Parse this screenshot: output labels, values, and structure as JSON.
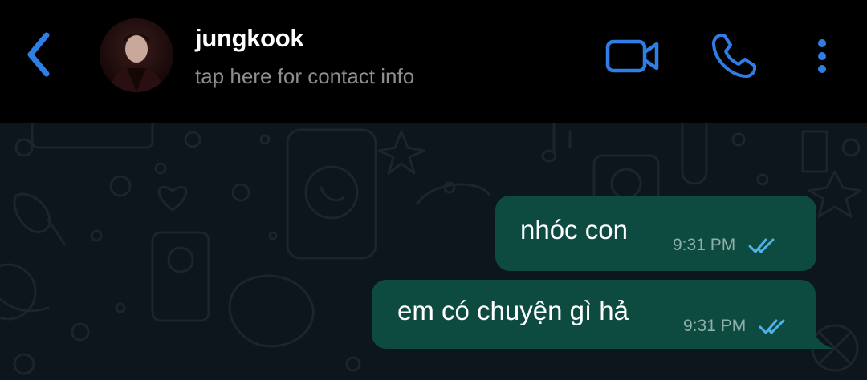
{
  "header": {
    "contact_name": "jungkook",
    "contact_subtitle": "tap here for contact info",
    "accent_color": "#2f7ee6"
  },
  "messages": [
    {
      "text": "nhóc con",
      "time": "9:31 PM",
      "status": "read"
    },
    {
      "text": "em có chuyện gì hả",
      "time": "9:31 PM",
      "status": "read"
    }
  ],
  "colors": {
    "header_bg": "#000000",
    "chat_bg": "#0c161c",
    "bubble_outgoing": "#0d4a40",
    "read_tick": "#4fb3e8"
  },
  "icons": [
    "back-chevron-icon",
    "video-camera-icon",
    "phone-icon",
    "more-vertical-icon",
    "double-check-icon"
  ]
}
